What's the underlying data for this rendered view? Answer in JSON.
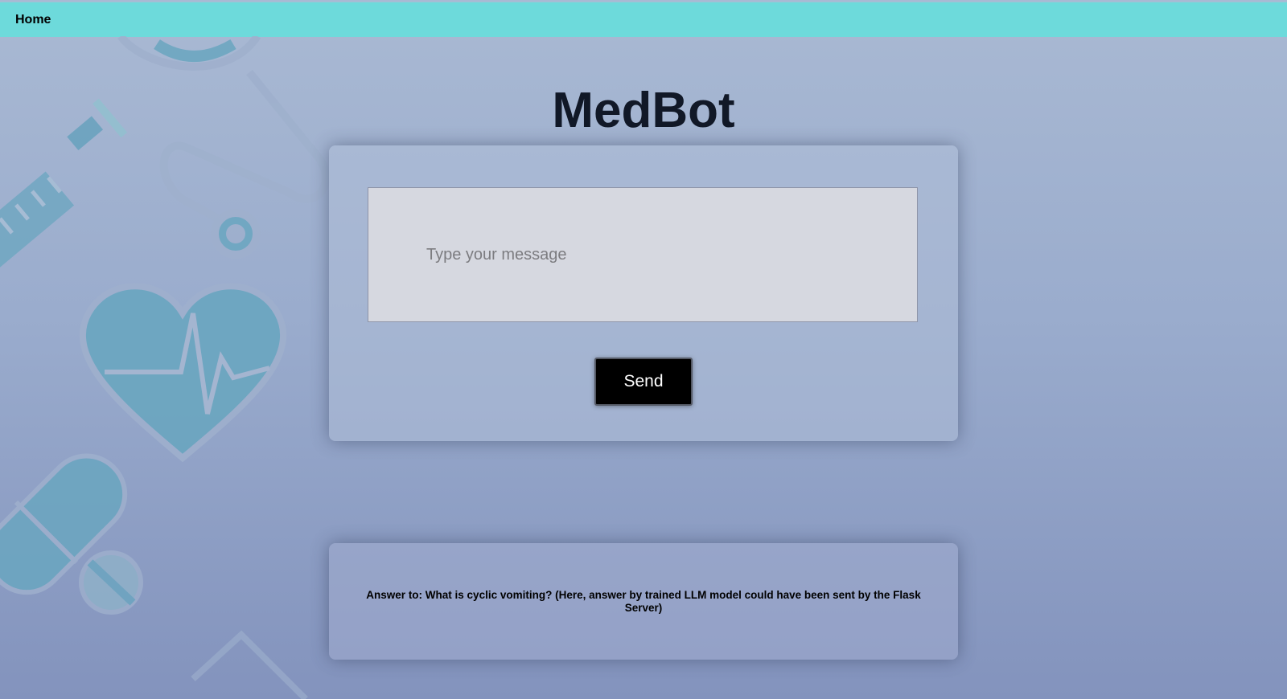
{
  "nav": {
    "home_label": "Home"
  },
  "page": {
    "title": "MedBot"
  },
  "chat": {
    "input_placeholder": "Type your message",
    "input_value": "",
    "send_label": "Send"
  },
  "answer": {
    "text": "Answer to: What is cyclic vomiting? (Here, answer by trained LLM model could have been sent by the Flask Server)"
  },
  "colors": {
    "topbar": "#6ddadb",
    "background_top": "#a9b9d3",
    "background_bottom": "#8393bd",
    "send_button": "#000000",
    "title": "#111827",
    "decor_icons": "#5f9fbb"
  },
  "decor_icons": [
    "stethoscope-icon",
    "syringe-icon",
    "heart-pulse-icon",
    "pill-icon",
    "tablet-icon"
  ]
}
